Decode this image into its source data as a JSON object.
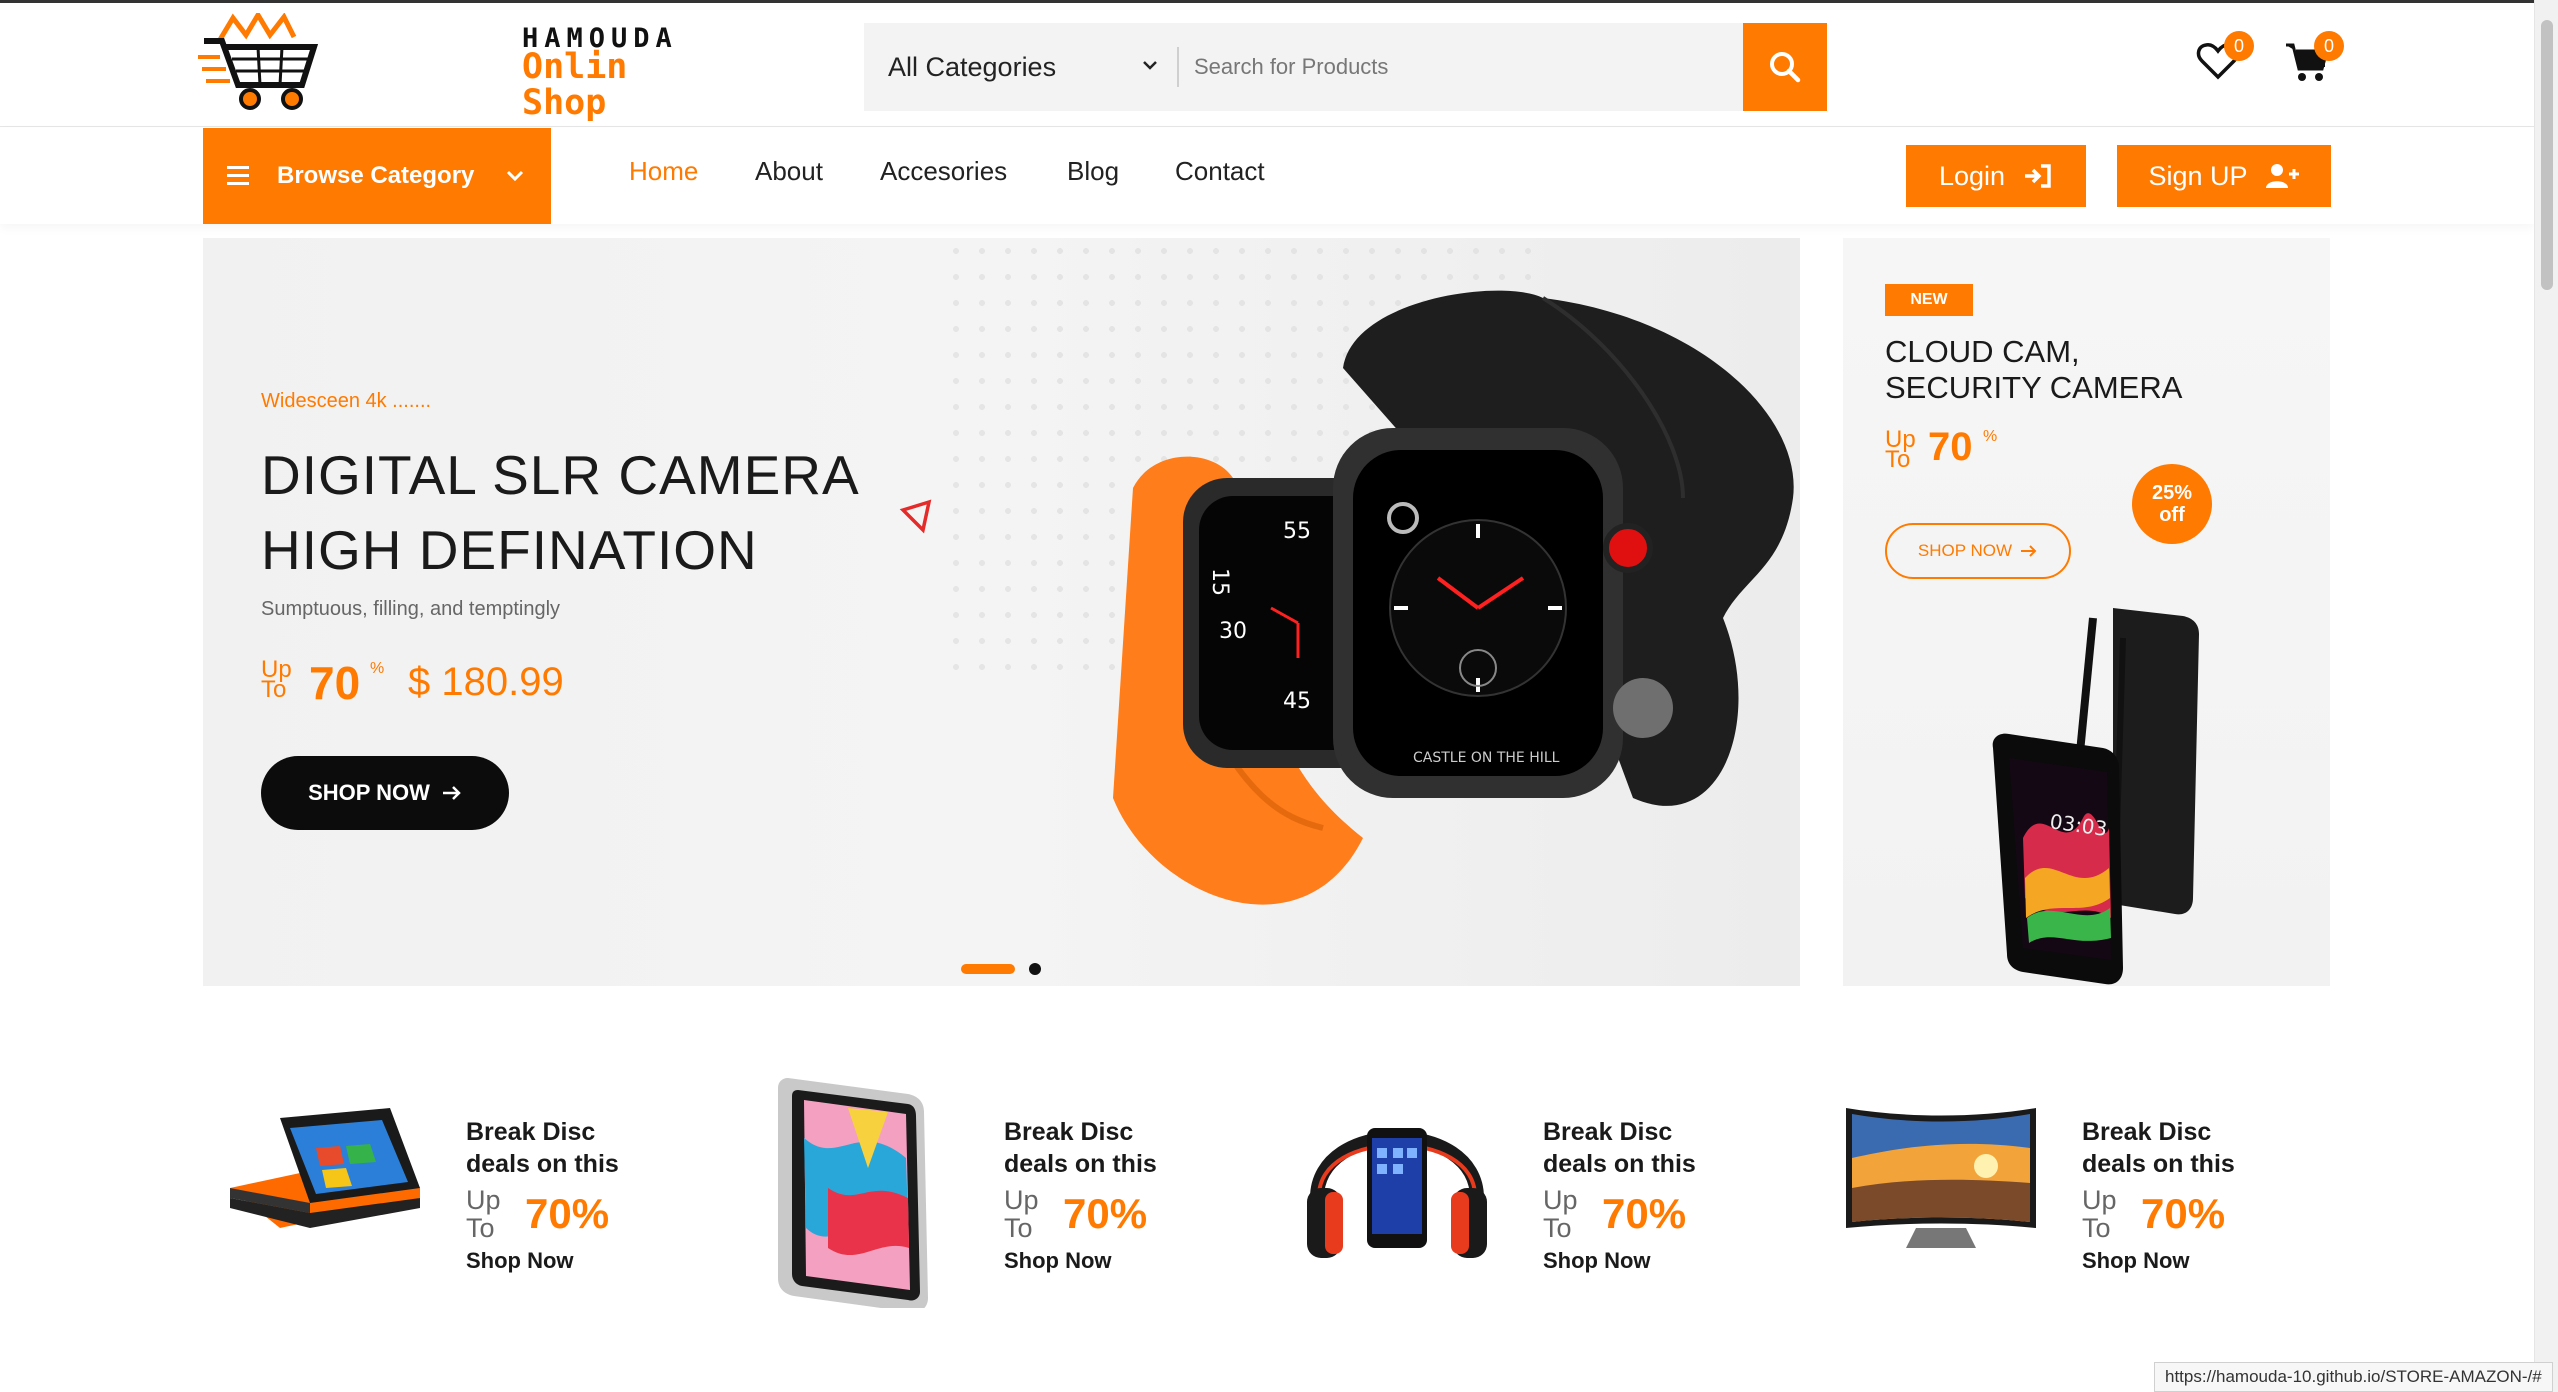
{
  "brand": {
    "line1": "HAMOUDA",
    "line2": "Onlin",
    "line3": "Shop"
  },
  "search": {
    "category": "All Categories",
    "placeholder": "Search for Products"
  },
  "header": {
    "wishlist_count": "0",
    "cart_count": "0"
  },
  "nav": {
    "browse_label": "Browse Category",
    "links": [
      "Home",
      "About",
      "Accesories",
      "Blog",
      "Contact"
    ],
    "active": "Home",
    "login_label": "Login",
    "signup_label": "Sign UP"
  },
  "hero": {
    "kicker": "Widesceen 4k .......",
    "title_line1": "DIGITAL SLR CAMERA",
    "title_line2": "HIGH DEFINATION",
    "subtitle": "Sumptuous, filling, and temptingly",
    "up": "Up",
    "to": "To",
    "percent": "70",
    "percent_sign": "%",
    "price": "$ 180.99",
    "cta": "SHOP NOW",
    "watch_label": "CASTLE ON THE HILL",
    "slides_total": 2,
    "active_slide": 1
  },
  "promo": {
    "tag": "NEW",
    "title_line1": "CLOUD CAM,",
    "title_line2": "SECURITY CAMERA",
    "up": "Up",
    "to": "To",
    "percent": "70",
    "percent_sign": "%",
    "badge_line1": "25%",
    "badge_line2": "off",
    "cta": "SHOP NOW",
    "phone_time": "03:03"
  },
  "deals": [
    {
      "icon": "laptop",
      "title1": "Break Disc",
      "title2": "deals on this",
      "up": "Up",
      "to": "To",
      "percent": "70%",
      "cta": "Shop Now"
    },
    {
      "icon": "tablet",
      "title1": "Break Disc",
      "title2": "deals on this",
      "up": "Up",
      "to": "To",
      "percent": "70%",
      "cta": "Shop Now"
    },
    {
      "icon": "headphones-phone",
      "title1": "Break Disc",
      "title2": "deals on this",
      "up": "Up",
      "to": "To",
      "percent": "70%",
      "cta": "Shop Now"
    },
    {
      "icon": "tv",
      "title1": "Break Disc",
      "title2": "deals on this",
      "up": "Up",
      "to": "To",
      "percent": "70%",
      "cta": "Shop Now"
    }
  ],
  "status_url": "https://hamouda-10.github.io/STORE-AMAZON-/#",
  "colors": {
    "accent": "#ff7a00",
    "dark": "#0c0c0c",
    "hero_bg": "#f1f1f1"
  }
}
